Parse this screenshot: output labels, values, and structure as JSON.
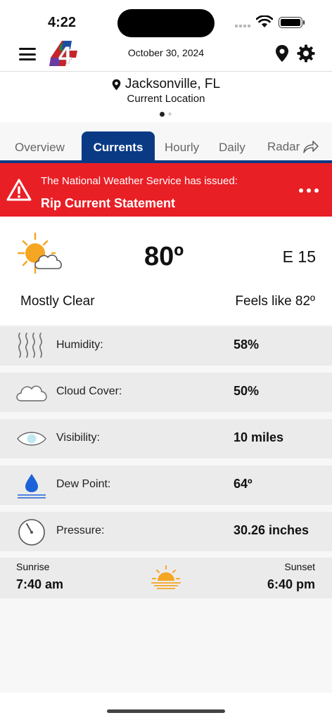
{
  "status_bar": {
    "time": "4:22"
  },
  "header": {
    "date": "October 30, 2024",
    "logo_text": "4"
  },
  "location": {
    "city": "Jacksonville, FL",
    "subtitle": "Current Location",
    "add_page": "+"
  },
  "tabs": [
    {
      "label": "Overview",
      "active": false
    },
    {
      "label": "Currents",
      "active": true
    },
    {
      "label": "Hourly",
      "active": false
    },
    {
      "label": "Daily",
      "active": false
    },
    {
      "label": "Radar",
      "active": false
    }
  ],
  "alert": {
    "line1": "The National Weather Service has issued:",
    "line2": "Rip Current Statement",
    "color": "#e91f26"
  },
  "currents": {
    "temperature": "80º",
    "wind": "E 15",
    "condition": "Mostly Clear",
    "feels_like": "Feels like 82º",
    "icon": "partly-cloudy-icon"
  },
  "details": [
    {
      "icon": "humidity-icon",
      "label": "Humidity:",
      "value": "58%"
    },
    {
      "icon": "cloud-icon",
      "label": "Cloud Cover:",
      "value": "50%"
    },
    {
      "icon": "eye-icon",
      "label": "Visibility:",
      "value": "10 miles"
    },
    {
      "icon": "droplet-icon",
      "label": "Dew Point:",
      "value": "64º"
    },
    {
      "icon": "gauge-icon",
      "label": "Pressure:",
      "value": "30.26 inches"
    }
  ],
  "sun": {
    "sunrise_label": "Sunrise",
    "sunrise_time": "7:40 am",
    "sunset_label": "Sunset",
    "sunset_time": "6:40 pm"
  },
  "colors": {
    "accent": "#0b3a85",
    "alert": "#e91f26",
    "sun": "#f5a623"
  }
}
